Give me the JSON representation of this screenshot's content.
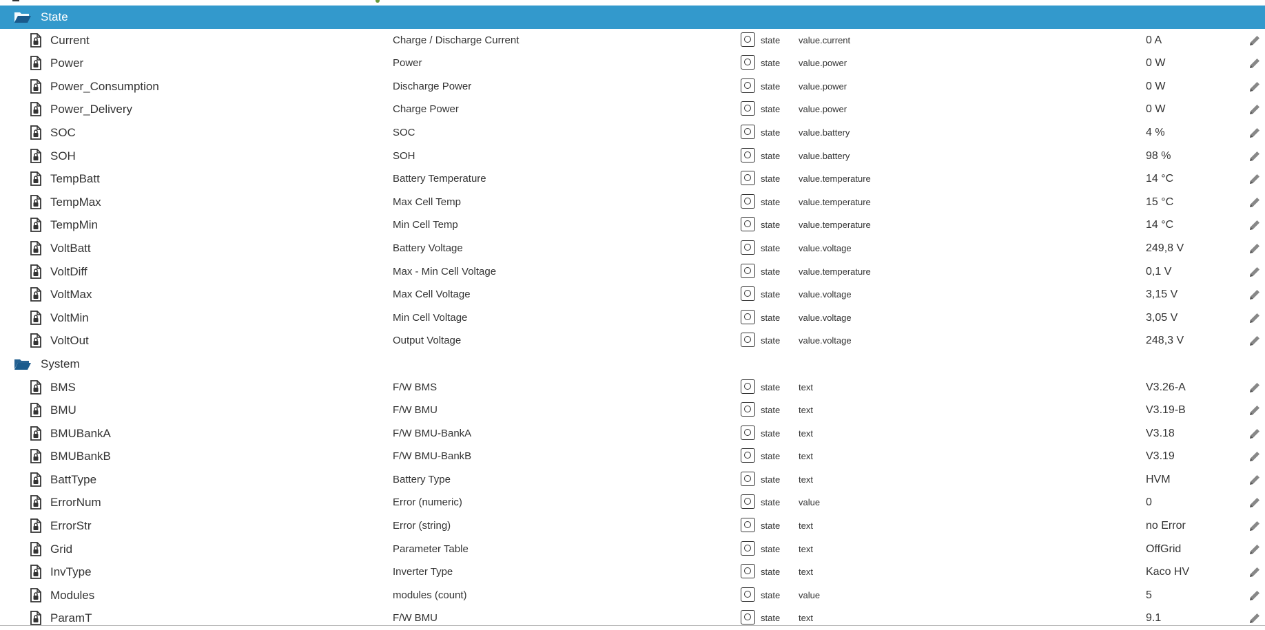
{
  "tree": [
    {
      "name": "State",
      "selected": true,
      "items": [
        {
          "name": "Current",
          "desc": "Charge / Discharge Current",
          "type": "state",
          "role": "value.current",
          "value": "0 A"
        },
        {
          "name": "Power",
          "desc": "Power",
          "type": "state",
          "role": "value.power",
          "value": "0 W"
        },
        {
          "name": "Power_Consumption",
          "desc": "Discharge Power",
          "type": "state",
          "role": "value.power",
          "value": "0 W"
        },
        {
          "name": "Power_Delivery",
          "desc": "Charge Power",
          "type": "state",
          "role": "value.power",
          "value": "0 W"
        },
        {
          "name": "SOC",
          "desc": "SOC",
          "type": "state",
          "role": "value.battery",
          "value": "4 %"
        },
        {
          "name": "SOH",
          "desc": "SOH",
          "type": "state",
          "role": "value.battery",
          "value": "98 %"
        },
        {
          "name": "TempBatt",
          "desc": "Battery Temperature",
          "type": "state",
          "role": "value.temperature",
          "value": "14 °C"
        },
        {
          "name": "TempMax",
          "desc": "Max Cell Temp",
          "type": "state",
          "role": "value.temperature",
          "value": "15 °C"
        },
        {
          "name": "TempMin",
          "desc": "Min Cell Temp",
          "type": "state",
          "role": "value.temperature",
          "value": "14 °C"
        },
        {
          "name": "VoltBatt",
          "desc": "Battery Voltage",
          "type": "state",
          "role": "value.voltage",
          "value": "249,8 V"
        },
        {
          "name": "VoltDiff",
          "desc": "Max - Min Cell Voltage",
          "type": "state",
          "role": "value.temperature",
          "value": "0,1 V"
        },
        {
          "name": "VoltMax",
          "desc": "Max Cell Voltage",
          "type": "state",
          "role": "value.voltage",
          "value": "3,15 V"
        },
        {
          "name": "VoltMin",
          "desc": "Min Cell Voltage",
          "type": "state",
          "role": "value.voltage",
          "value": "3,05 V"
        },
        {
          "name": "VoltOut",
          "desc": "Output Voltage",
          "type": "state",
          "role": "value.voltage",
          "value": "248,3 V"
        }
      ]
    },
    {
      "name": "System",
      "selected": false,
      "items": [
        {
          "name": "BMS",
          "desc": "F/W BMS",
          "type": "state",
          "role": "text",
          "value": "V3.26-A"
        },
        {
          "name": "BMU",
          "desc": "F/W BMU",
          "type": "state",
          "role": "text",
          "value": "V3.19-B"
        },
        {
          "name": "BMUBankA",
          "desc": "F/W BMU-BankA",
          "type": "state",
          "role": "text",
          "value": "V3.18"
        },
        {
          "name": "BMUBankB",
          "desc": "F/W BMU-BankB",
          "type": "state",
          "role": "text",
          "value": "V3.19"
        },
        {
          "name": "BattType",
          "desc": "Battery Type",
          "type": "state",
          "role": "text",
          "value": "HVM"
        },
        {
          "name": "ErrorNum",
          "desc": "Error (numeric)",
          "type": "state",
          "role": "value",
          "value": "0"
        },
        {
          "name": "ErrorStr",
          "desc": "Error (string)",
          "type": "state",
          "role": "text",
          "value": "no Error"
        },
        {
          "name": "Grid",
          "desc": "Parameter Table",
          "type": "state",
          "role": "text",
          "value": "OffGrid"
        },
        {
          "name": "InvType",
          "desc": "Inverter Type",
          "type": "state",
          "role": "text",
          "value": "Kaco HV"
        },
        {
          "name": "Modules",
          "desc": "modules (count)",
          "type": "state",
          "role": "value",
          "value": "5"
        },
        {
          "name": "ParamT",
          "desc": "F/W BMU",
          "type": "state",
          "role": "text",
          "value": "9.1"
        }
      ]
    }
  ],
  "icons": {
    "folder": "folder-open-icon",
    "file": "file-lock-icon",
    "state_button": "state-circle-icon",
    "edit": "pencil-icon"
  },
  "colors": {
    "selected_row": "#3399cc",
    "folder_icon": "#1a5a8c",
    "text": "#333333"
  }
}
